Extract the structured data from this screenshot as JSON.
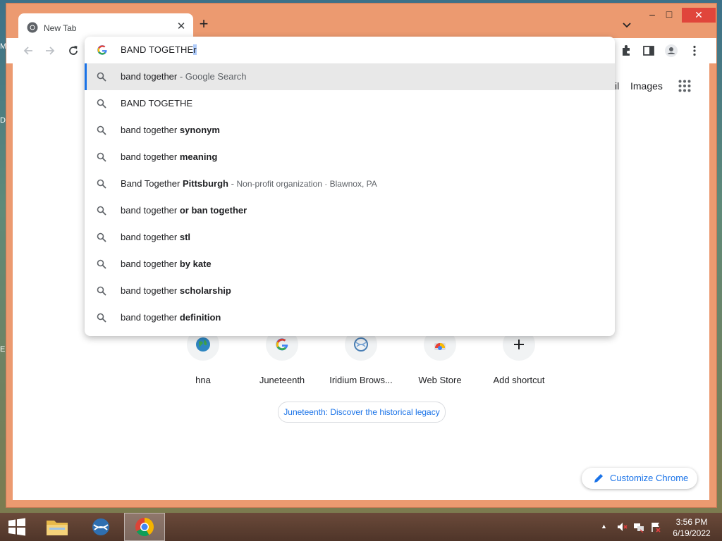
{
  "browser": {
    "tab": {
      "title": "New Tab"
    },
    "newtab_label": "+",
    "window_controls": {
      "minimize": "–",
      "maximize": "□",
      "close": "✕"
    }
  },
  "omnibox": {
    "input": {
      "value_prefix": "BAND TOGETHE",
      "value_selected": "r"
    },
    "suggestions": [
      {
        "plain": "band together",
        "bold": "",
        "suffix": " - Google Search",
        "detail": ""
      },
      {
        "plain": "BAND TOGETHE",
        "bold": "",
        "suffix": "",
        "detail": ""
      },
      {
        "plain": "band together ",
        "bold": "synonym",
        "suffix": "",
        "detail": ""
      },
      {
        "plain": "band together ",
        "bold": "meaning",
        "suffix": "",
        "detail": ""
      },
      {
        "plain": "Band Together ",
        "bold": "Pittsburgh",
        "suffix": " - ",
        "detail": "Non-profit organization · Blawnox, PA"
      },
      {
        "plain": "band together ",
        "bold": "or ban together",
        "suffix": "",
        "detail": ""
      },
      {
        "plain": "band together ",
        "bold": "stl",
        "suffix": "",
        "detail": ""
      },
      {
        "plain": "band together ",
        "bold": "by kate",
        "suffix": "",
        "detail": ""
      },
      {
        "plain": "band together ",
        "bold": "scholarship",
        "suffix": "",
        "detail": ""
      },
      {
        "plain": "band together ",
        "bold": "definition",
        "suffix": "",
        "detail": ""
      }
    ]
  },
  "ntp": {
    "gmail_partial": "il",
    "images_link": "Images",
    "shortcuts": [
      {
        "label": "hna",
        "icon": "globe-icon"
      },
      {
        "label": "Juneteenth",
        "icon": "google-icon"
      },
      {
        "label": "Iridium Brows...",
        "icon": "iridium-icon"
      },
      {
        "label": "Web Store",
        "icon": "webstore-icon"
      },
      {
        "label": "Add shortcut",
        "icon": "plus-icon"
      }
    ],
    "doodle_chip": "Juneteenth: Discover the historical legacy",
    "customize": "Customize Chrome"
  },
  "taskbar": {
    "time": "3:56 PM",
    "date": "6/19/2022",
    "tray_arrow": "▲"
  },
  "desktop_icon_letters": [
    "M",
    "D",
    "E"
  ],
  "colors": {
    "window_frame": "#ec9a70",
    "close": "#e0453b",
    "accent": "#1a73e8"
  }
}
